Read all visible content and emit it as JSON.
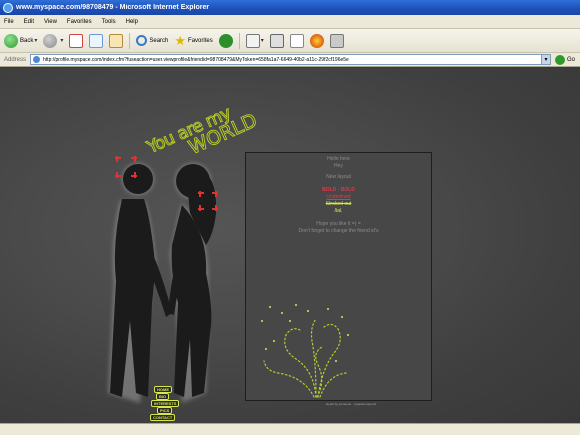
{
  "window": {
    "title": "www.myspace.com/98708479 - Microsoft Internet Explorer"
  },
  "menu": [
    "File",
    "Edit",
    "View",
    "Favorites",
    "Tools",
    "Help"
  ],
  "toolbar": {
    "back_label": "Back",
    "search_label": "Search",
    "favorites_label": "Favorites"
  },
  "address": {
    "label": "Address",
    "url": "http://profile.myspace.com/index.cfm?fuseaction=user.viewprofile&friendid=98708479&MyToken=658fa1a7-6649-40b2-a11c-29f2cf196e5e",
    "go_label": "Go"
  },
  "headline": {
    "line1": "You are my",
    "line2": "WORLD"
  },
  "nav_links": [
    "HOME",
    "BIO",
    "INTERESTS",
    "PICS",
    "CONTACT"
  ],
  "content": {
    "greeting1": "Hello here",
    "greeting2": "Hey",
    "new_layout": "New layout",
    "bold_text": "BOLD - BOLD",
    "underlined": "Underlined",
    "strike": "Stroked out",
    "italic": "Ital.",
    "hope": "Hope you like it =) =",
    "reminder": "Don't forget to change the friend id's"
  },
  "footer": "layout by someone · myspace layouts",
  "colors": {
    "accent_lime": "#b7cc2a",
    "accent_red": "#e8344a",
    "page_bg": "#474747"
  }
}
